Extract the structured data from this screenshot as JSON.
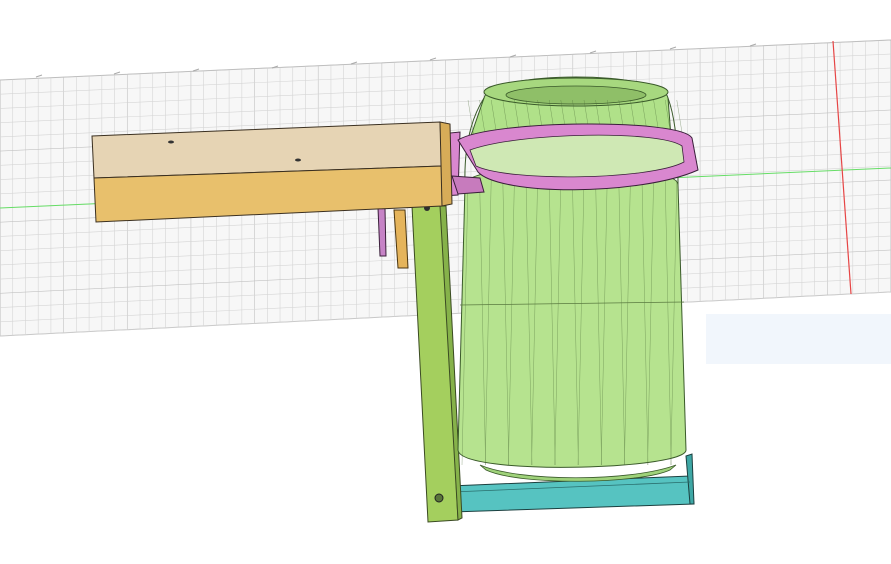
{
  "viewport": {
    "background": "#ffffff",
    "grid_color": "#c9c9c9",
    "axis_x_color": "#e03a3a",
    "axis_y_color": "#4bd06a"
  },
  "model": {
    "name": "",
    "parts": [
      {
        "name": "can",
        "color": "#b6e38f"
      },
      {
        "name": "ring-holder",
        "color": "#d987cf"
      },
      {
        "name": "arm-plate",
        "color": "#e8c06c"
      },
      {
        "name": "arm-top",
        "color": "#e6d4b4"
      },
      {
        "name": "vertical-bar",
        "color": "#a4cf5e"
      },
      {
        "name": "base-bracket",
        "color": "#56c3c1"
      },
      {
        "name": "small-pin-purple",
        "color": "#c683c6"
      },
      {
        "name": "small-pin-orange",
        "color": "#e5b45b"
      }
    ]
  }
}
